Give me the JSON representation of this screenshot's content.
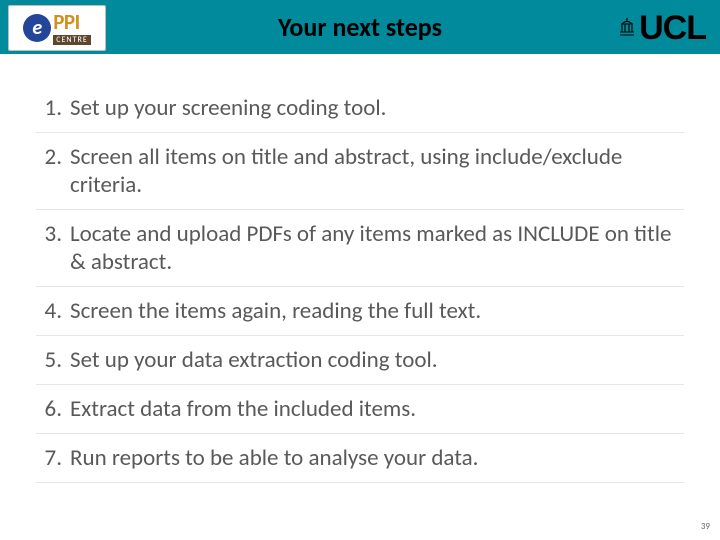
{
  "header": {
    "title": "Your next steps",
    "logo_left": {
      "e": "e",
      "ppi": "PPI",
      "centre": "CENTRE"
    },
    "logo_right": {
      "dome": "♔",
      "text": "UCL"
    }
  },
  "steps": [
    {
      "n": "1.",
      "t": "Set up your screening coding tool."
    },
    {
      "n": "2.",
      "t": "Screen all items on title and abstract, using include/exclude criteria."
    },
    {
      "n": "3.",
      "t": "Locate and upload PDFs of any items marked as INCLUDE on title & abstract."
    },
    {
      "n": "4.",
      "t": "Screen the items again, reading the full text."
    },
    {
      "n": "5.",
      "t": "Set up your data extraction coding tool."
    },
    {
      "n": "6.",
      "t": "Extract data from the included items."
    },
    {
      "n": "7.",
      "t": "Run reports to be able to analyse your data."
    }
  ],
  "slide_number": "39"
}
